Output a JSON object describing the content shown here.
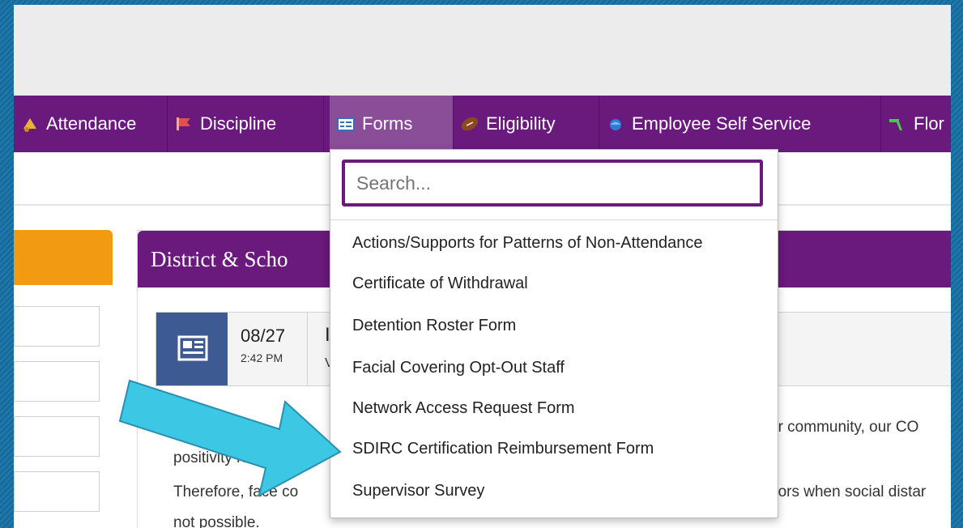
{
  "nav": {
    "items": [
      {
        "label": "Attendance",
        "icon": "bell-icon"
      },
      {
        "label": "Discipline",
        "icon": "flag-icon"
      },
      {
        "label": "Forms",
        "icon": "form-icon"
      },
      {
        "label": "Eligibility",
        "icon": "football-icon"
      },
      {
        "label": "Employee Self Service",
        "icon": "globe-icon"
      },
      {
        "label": "Flor",
        "icon": "florida-icon"
      }
    ],
    "active": "Forms"
  },
  "forms_menu": {
    "search_placeholder": "Search...",
    "items": [
      "Actions/Supports for Patterns of Non-Attendance",
      "Certificate of Withdrawal",
      "Detention Roster Form",
      "Facial Covering Opt-Out Staff",
      "Network Access Request Form",
      "SDIRC Certification Reimbursement Form",
      "Supervisor Survey"
    ]
  },
  "news": {
    "title": "District & Scho",
    "item_date": "08/27",
    "item_time": "2:42 PM",
    "item_title_partial": "I",
    "item_sub_partial": "V",
    "body": {
      "line1_right": "ur community, our CO",
      "line2_left": "positivity rate",
      "line3_left": "Therefore, face co",
      "line3_right": "oors when social distar",
      "line4_left": "not possible."
    }
  },
  "colors": {
    "nav_bg": "#6a1a7c",
    "nav_active": "#8a4d98",
    "orange_panel": "#f29a12",
    "arrow": "#3cc8e4",
    "news_icon_bg": "#3d5a93"
  }
}
